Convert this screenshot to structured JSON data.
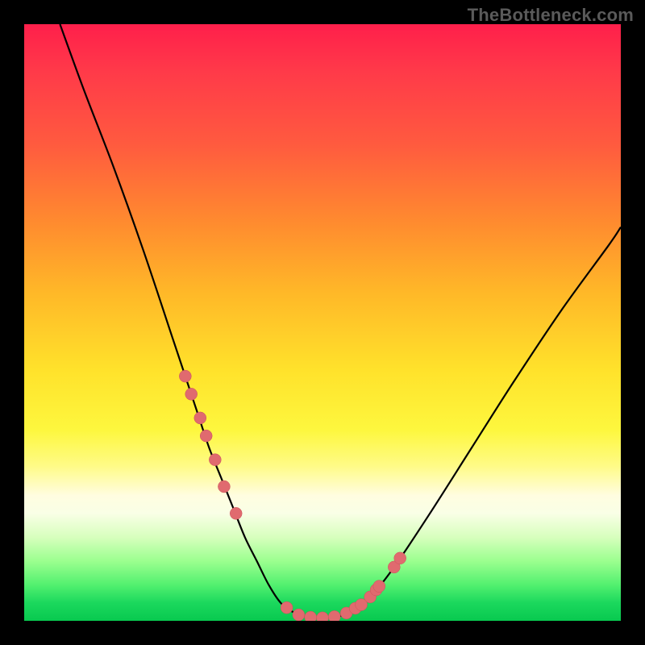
{
  "attribution": "TheBottleneck.com",
  "colors": {
    "frame": "#000000",
    "gradient_top": "#ff1f4b",
    "gradient_bottom": "#08c94f",
    "curve": "#000000",
    "dots": "#e06a6f"
  },
  "chart_data": {
    "type": "line",
    "title": "",
    "xlabel": "",
    "ylabel": "",
    "xlim": [
      0,
      100
    ],
    "ylim": [
      0,
      100
    ],
    "series": [
      {
        "name": "bottleneck-curve",
        "x": [
          6,
          10,
          15,
          20,
          25,
          27,
          29,
          31,
          33,
          35,
          37,
          39,
          41,
          43,
          45,
          47,
          49,
          51,
          53,
          55,
          58,
          62,
          68,
          75,
          82,
          90,
          98,
          100
        ],
        "y": [
          100,
          89,
          76,
          62,
          47,
          41,
          35,
          29,
          24,
          19,
          14,
          10,
          6,
          3,
          1.5,
          0.8,
          0.5,
          0.5,
          0.8,
          1.8,
          4,
          9,
          18,
          29,
          40,
          52,
          63,
          66
        ]
      }
    ],
    "points": {
      "name": "highlighted-samples",
      "x": [
        27,
        28,
        29.5,
        30.5,
        32,
        33.5,
        35.5,
        44,
        46,
        48,
        50,
        52,
        54,
        55.5,
        56.5,
        58,
        59,
        59.5,
        62,
        63
      ],
      "y": [
        41,
        38,
        34,
        31,
        27,
        22.5,
        18,
        2.2,
        1,
        0.6,
        0.5,
        0.7,
        1.3,
        2.1,
        2.7,
        4,
        5.2,
        5.8,
        9,
        10.5
      ]
    }
  }
}
